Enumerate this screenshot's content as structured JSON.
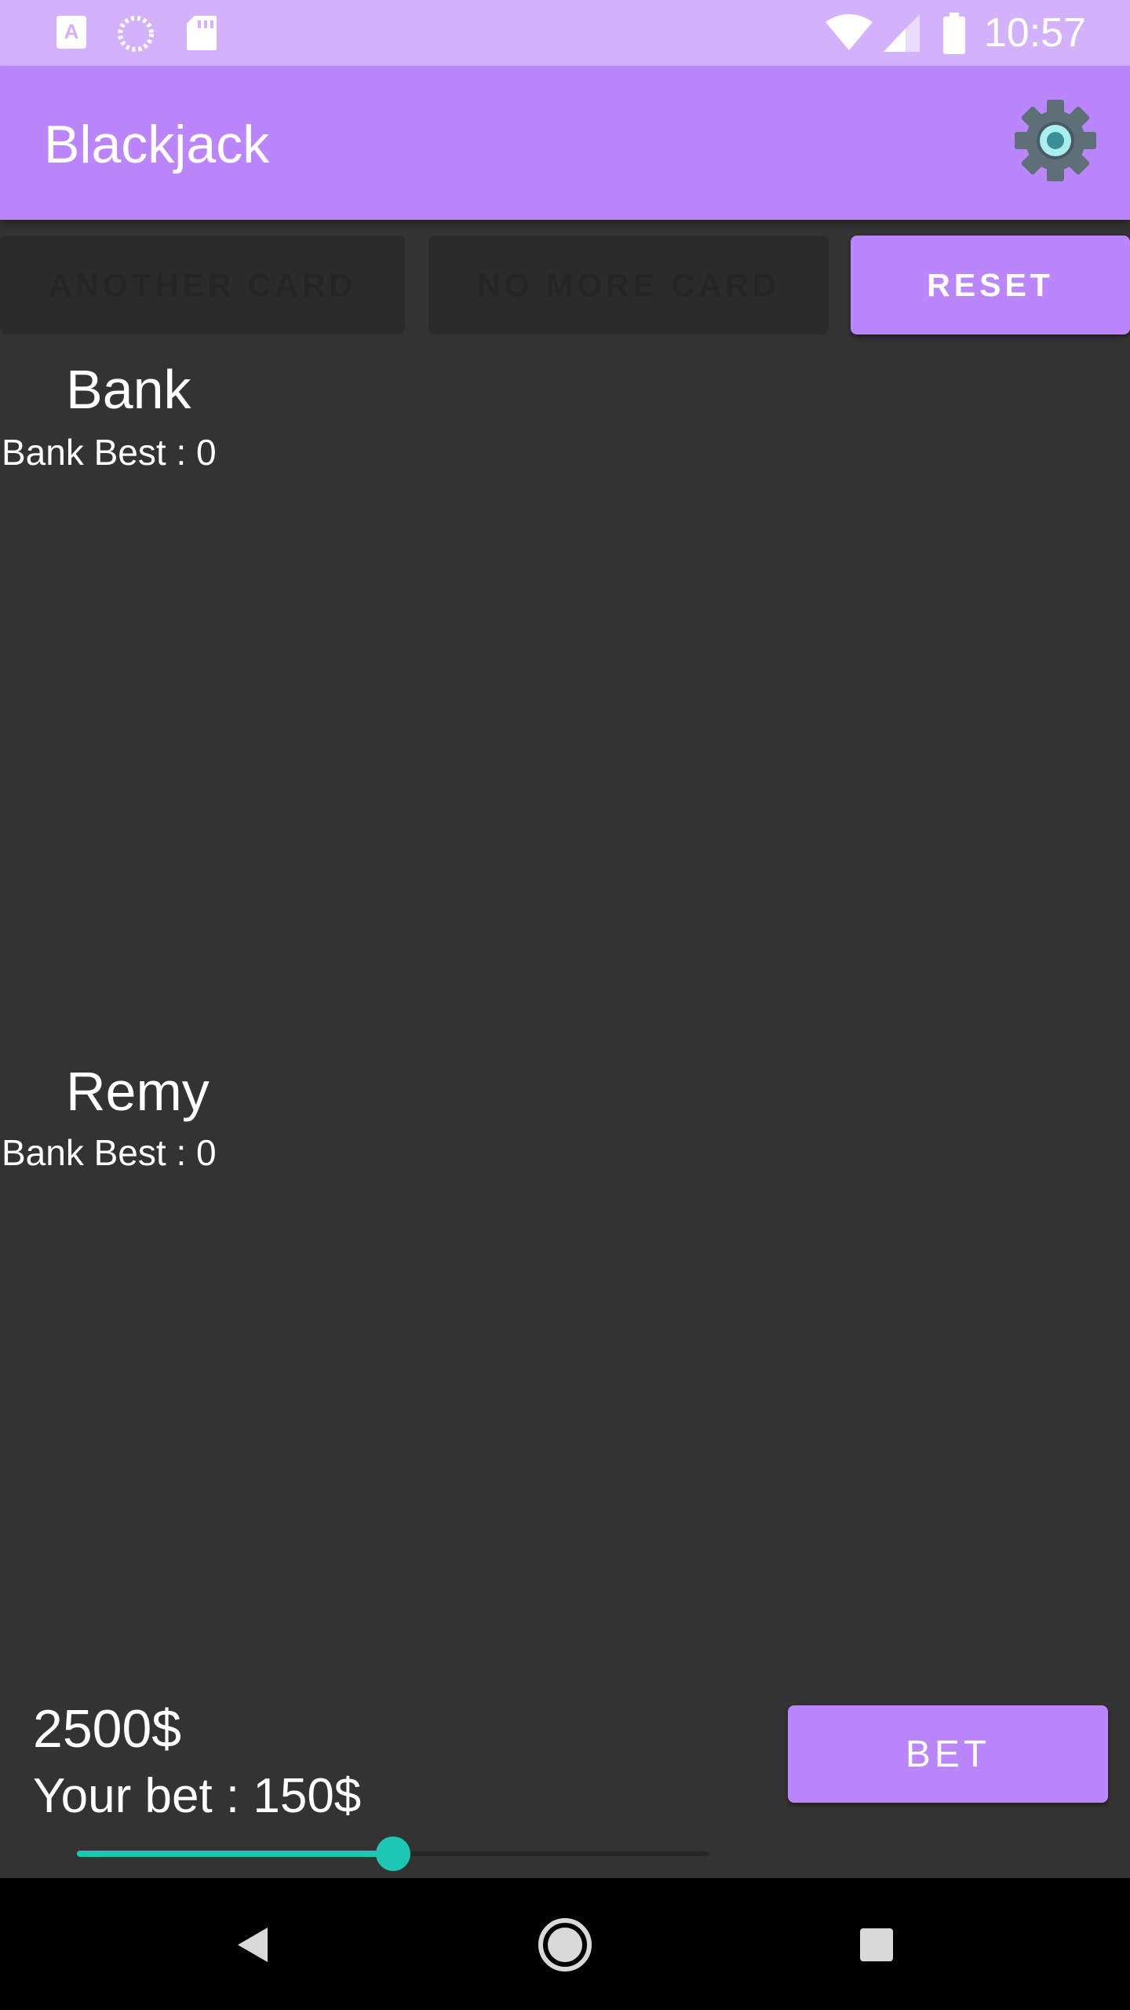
{
  "status_bar": {
    "time": "10:57",
    "icons": [
      "font-notification-icon",
      "sync-icon",
      "sd-card-icon",
      "wifi-icon",
      "signal-icon",
      "battery-icon"
    ]
  },
  "app_bar": {
    "title": "Blackjack",
    "settings_icon": "settings-icon"
  },
  "actions": {
    "another_card": "ANOTHER CARD",
    "no_more_card": "NO MORE CARD",
    "reset": "RESET"
  },
  "bank": {
    "name": "Bank",
    "best_label": "Bank Best : 0"
  },
  "player": {
    "name": "Remy",
    "best_label": "Bank Best : 0"
  },
  "footer": {
    "balance": "2500$",
    "your_bet": "Your bet : 150$",
    "bet_button": "BET",
    "bet_slider_fraction": 0.5
  },
  "colors": {
    "primary": "#bb86fc",
    "status_bar": "#d3b2fb",
    "background": "#333333",
    "accent": "#1cc8b4"
  },
  "nav_bar": {
    "icons": [
      "back-icon",
      "home-icon",
      "recents-icon"
    ]
  }
}
